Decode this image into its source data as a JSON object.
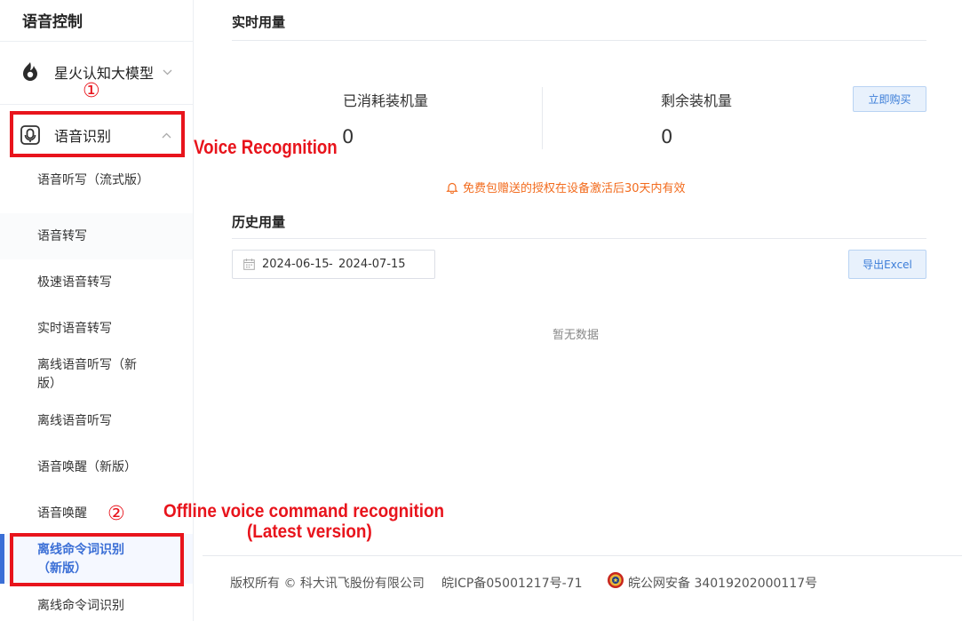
{
  "sidebar": {
    "title": "语音控制",
    "group1": {
      "label": "星火认知大模型"
    },
    "group2": {
      "label": "语音识别"
    },
    "items": [
      {
        "label": "语音听写（流式版）"
      },
      {
        "label": "语音转写"
      },
      {
        "label": "极速语音转写"
      },
      {
        "label": "实时语音转写"
      },
      {
        "label": "离线语音听写（新版）"
      },
      {
        "label": "离线语音听写"
      },
      {
        "label": "语音唤醒（新版）"
      },
      {
        "label": "语音唤醒"
      },
      {
        "label": "离线命令词识别（新版）"
      },
      {
        "label": "离线命令词识别"
      }
    ]
  },
  "annotations": {
    "num1": "①",
    "num2": "②",
    "voice_recognition": "Voice Recognition",
    "offline_line1": "Offline voice command recognition",
    "offline_line2": "(Latest version)"
  },
  "realtime": {
    "title": "实时用量",
    "consumed_label": "已消耗装机量",
    "consumed_value": "0",
    "remaining_label": "剩余装机量",
    "remaining_value": "0",
    "buy_button": "立即购买",
    "notice": "免费包赠送的授权在设备激活后30天内有效"
  },
  "history": {
    "title": "历史用量",
    "date_start": "2024-06-15",
    "date_sep": "-",
    "date_end": "2024-07-15",
    "export_button": "导出Excel",
    "empty_text": "暂无数据"
  },
  "footer": {
    "copyright": "版权所有 © 科大讯飞股份有限公司",
    "icp": "皖ICP备05001217号-71",
    "police": "皖公网安备 34019202000117号"
  },
  "colors": {
    "accent": "#3b6fd6",
    "annotation": "#e8141c",
    "notice": "#f26b1d"
  },
  "icons": {
    "group1": "flame-logo-icon",
    "group2": "mic-icon",
    "notice": "bell-icon",
    "date": "calendar-icon",
    "footer": "police-badge-icon"
  }
}
